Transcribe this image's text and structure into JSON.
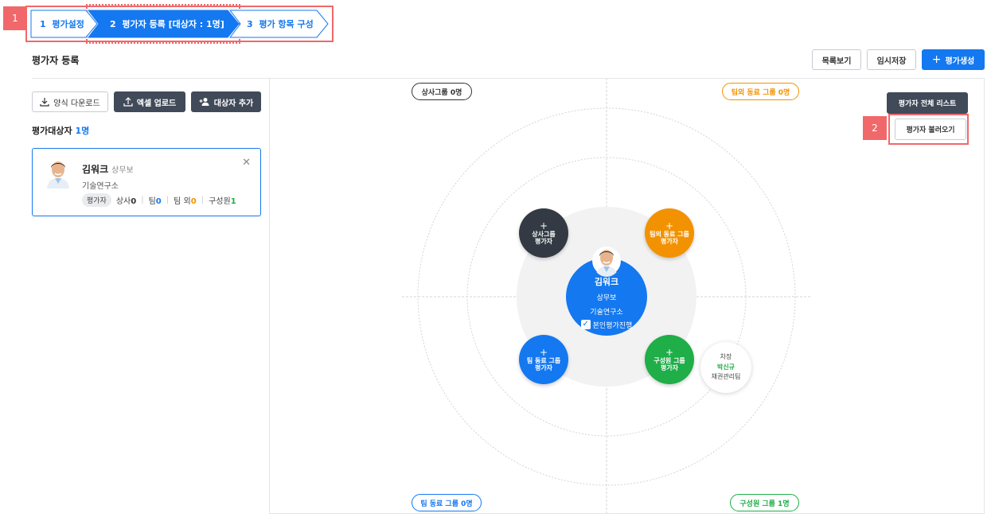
{
  "annotations": {
    "step_marker": "1",
    "load_marker": "2"
  },
  "stepper": {
    "steps": [
      {
        "num": "1",
        "label": "평가설정"
      },
      {
        "num": "2",
        "label": "평가자 등록 [대상자 : 1명]"
      },
      {
        "num": "3",
        "label": "평가 항목 구성"
      }
    ]
  },
  "page": {
    "section_title": "평가자 등록"
  },
  "header_actions": {
    "list_view": "목록보기",
    "temp_save": "임시저장",
    "create": "평가생성"
  },
  "left_panel": {
    "download": "양식 다운로드",
    "excel_upload": "엑셀 업로드",
    "add_target": "대상자 추가",
    "target_label": "평가대상자",
    "target_count": "1명",
    "card": {
      "name": "김워크",
      "rank": "상무보",
      "dept": "기술연구소",
      "role_pill": "평가자",
      "stats": [
        {
          "label": "상사",
          "value": "0"
        },
        {
          "label": "팀",
          "value": "0"
        },
        {
          "label": "팀 외",
          "value": "0"
        },
        {
          "label": "구성원",
          "value": "1"
        }
      ]
    }
  },
  "diagram": {
    "all_list": "평가자 전체 리스트",
    "load": "평가자 불러오기",
    "tags": {
      "superior": "상사그룹 0명",
      "outside": "팀외 동료 그룹 0명",
      "team": "팀 동료 그룹 0명",
      "member": "구성원 그룹 1명"
    },
    "nodes": {
      "superior": {
        "plus": "+",
        "line1": "상사그룹",
        "line2": "평가자"
      },
      "outside": {
        "plus": "+",
        "line1": "팀외 동료 그룹",
        "line2": "평가자"
      },
      "team": {
        "plus": "+",
        "line1": "팀 동료 그룹",
        "line2": "평가자"
      },
      "member": {
        "plus": "+",
        "line1": "구성원 그룹",
        "line2": "평가자"
      }
    },
    "center": {
      "name": "김워크",
      "rank": "상무보",
      "dept": "기술연구소",
      "self_eval": "본인평가진행",
      "self_checked": true
    },
    "member_person": {
      "rank": "차장",
      "name": "박신규",
      "dept": "채권관리팀"
    }
  },
  "colors": {
    "blue": "#1478f0",
    "dark": "#414a59",
    "orange": "#f39200",
    "green": "#1fae48",
    "annotation": "#f0686a"
  }
}
